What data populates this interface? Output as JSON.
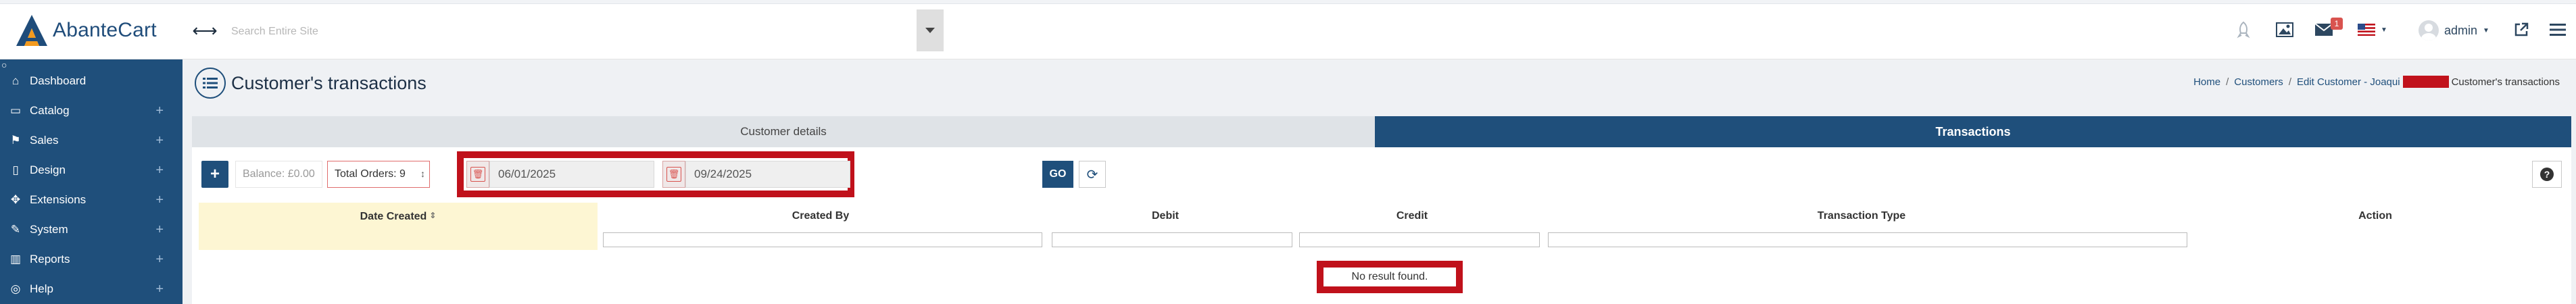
{
  "brand": {
    "logo_text": "AbanteCart",
    "accent": "#1f4f7b",
    "highlight": "#c0111b"
  },
  "topbar": {
    "search_placeholder": "Search Entire Site",
    "notification_count": "1",
    "user_name": "admin",
    "icons": [
      "collapse-arrows-icon",
      "rocket-icon",
      "image-icon",
      "envelope-icon",
      "flag-us-icon",
      "avatar-icon",
      "external-link-icon",
      "hamburger-icon"
    ]
  },
  "sidebar": {
    "items": [
      {
        "label": "Dashboard",
        "icon": "home-icon",
        "expandable": false
      },
      {
        "label": "Catalog",
        "icon": "folder-icon",
        "expandable": true
      },
      {
        "label": "Sales",
        "icon": "flag-icon",
        "expandable": true
      },
      {
        "label": "Design",
        "icon": "file-icon",
        "expandable": true
      },
      {
        "label": "Extensions",
        "icon": "puzzle-icon",
        "expandable": true
      },
      {
        "label": "System",
        "icon": "wrench-icon",
        "expandable": true
      },
      {
        "label": "Reports",
        "icon": "bar-chart-icon",
        "expandable": true
      },
      {
        "label": "Help",
        "icon": "life-ring-icon",
        "expandable": true
      }
    ]
  },
  "page": {
    "title": "Customer's transactions",
    "breadcrumb": {
      "home": "Home",
      "customers": "Customers",
      "edit": "Edit Customer - Joaqui",
      "current": "Customer's transactions"
    }
  },
  "tabs": {
    "details": "Customer details",
    "transactions": "Transactions"
  },
  "toolbar": {
    "add_label": "+",
    "balance": "Balance: £0.00",
    "total_orders": "Total Orders: 9",
    "date_from": "06/01/2025",
    "date_to": "09/24/2025",
    "go_label": "GO"
  },
  "table": {
    "columns": [
      "Date Created",
      "Created By",
      "Debit",
      "Credit",
      "Transaction Type",
      "Action"
    ],
    "empty_message": "No result found."
  }
}
